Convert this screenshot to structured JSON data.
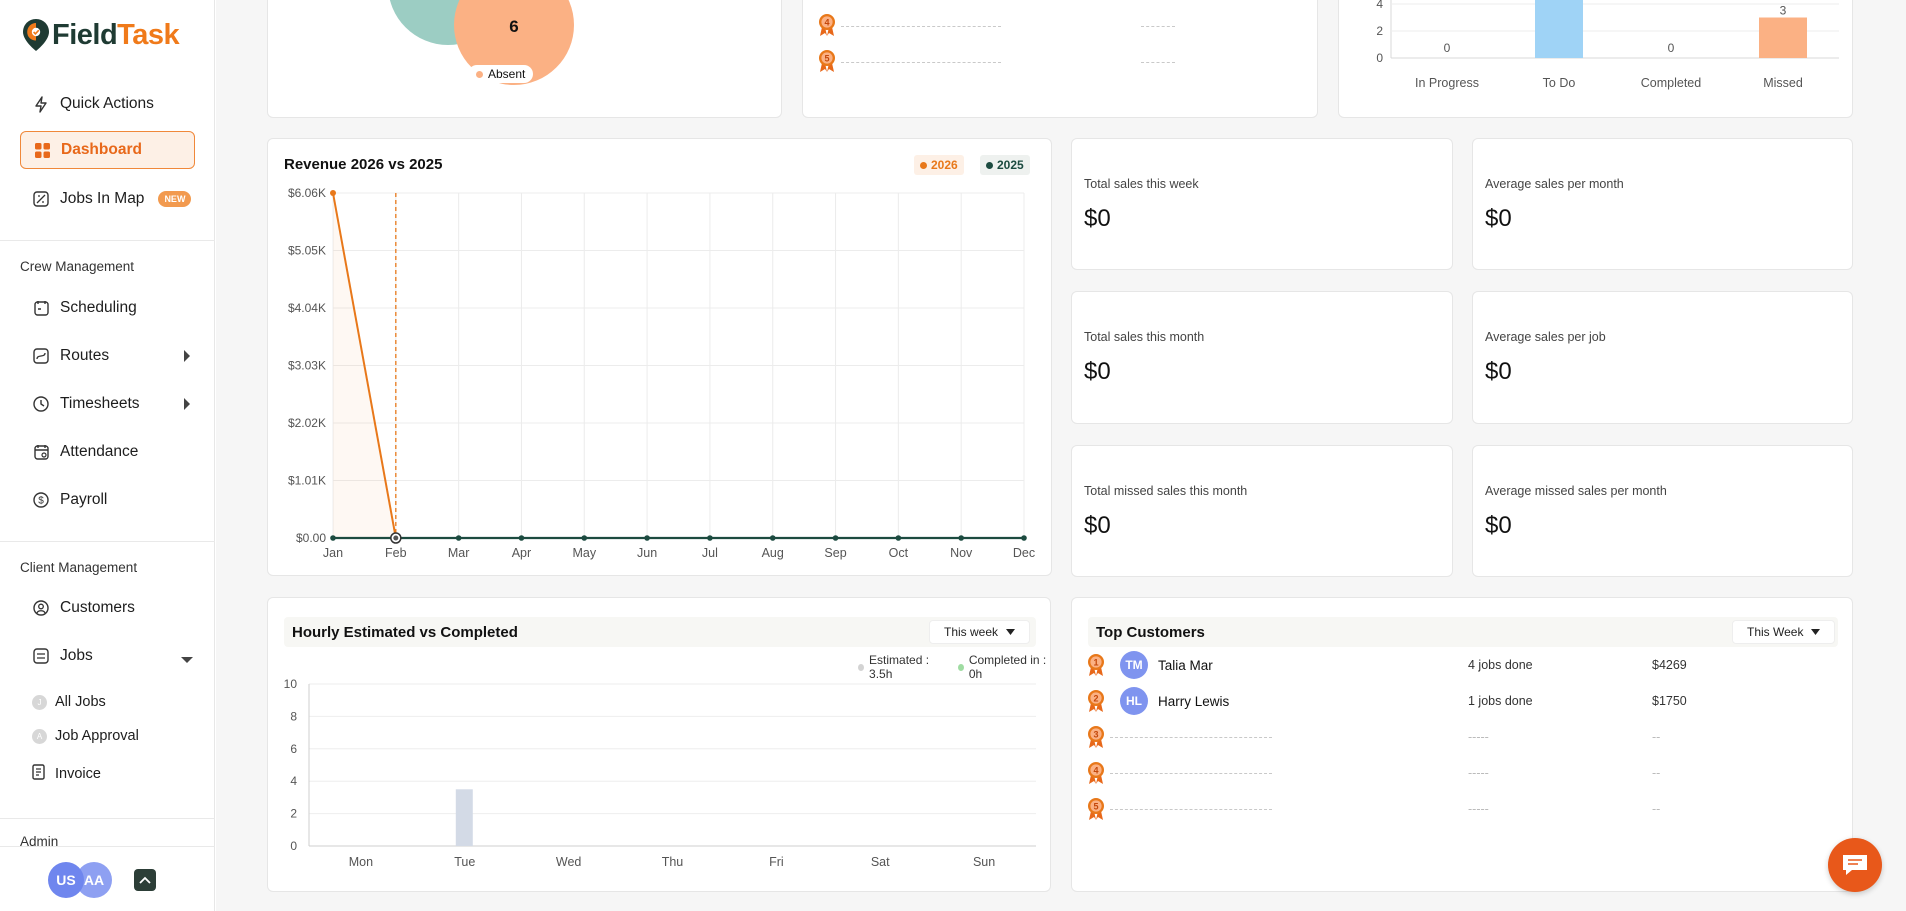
{
  "brand": {
    "name_a": "Field",
    "name_b": "Task"
  },
  "sidebar": {
    "quick_actions": "Quick Actions",
    "dashboard": "Dashboard",
    "jobs_in_map": "Jobs In Map",
    "new_badge": "NEW",
    "crew_management": "Crew Management",
    "scheduling": "Scheduling",
    "routes": "Routes",
    "timesheets": "Timesheets",
    "attendance": "Attendance",
    "payroll": "Payroll",
    "client_management": "Client Management",
    "customers": "Customers",
    "jobs": "Jobs",
    "all_jobs": "All Jobs",
    "job_approval": "Job Approval",
    "invoice": "Invoice",
    "admin": "Admin",
    "avatars": [
      "US",
      "AA"
    ]
  },
  "attendance_card": {
    "bubble_value": "6",
    "legend_absent": "Absent"
  },
  "top_card_ranks": [
    "4",
    "5"
  ],
  "job_status_chart": {
    "y_ticks": [
      "0",
      "2",
      "4"
    ],
    "categories": [
      "In Progress",
      "To Do",
      "Completed",
      "Missed"
    ],
    "values": [
      0,
      5,
      0,
      3
    ],
    "labels": [
      "0",
      "",
      "0",
      "3"
    ],
    "colors": [
      "#9fd3f6",
      "#9fd3f6",
      "#9fd3f6",
      "#fbb184"
    ]
  },
  "revenue": {
    "title": "Revenue 2026 vs 2025",
    "legend_2026": "2026",
    "legend_2025": "2025",
    "color_2026": "#e8781a",
    "color_2025": "#1c4b40",
    "y_ticks": [
      "$0.00",
      "$1.01K",
      "$2.02K",
      "$3.03K",
      "$4.04K",
      "$5.05K",
      "$6.06K"
    ]
  },
  "stats": {
    "total_week_label": "Total sales this week",
    "total_week_value": "$0",
    "avg_month_label": "Average sales per month",
    "avg_month_value": "$0",
    "total_month_label": "Total sales this month",
    "total_month_value": "$0",
    "avg_job_label": "Average sales per job",
    "avg_job_value": "$0",
    "missed_month_label": "Total missed sales this month",
    "missed_month_value": "$0",
    "avg_missed_label": "Average missed sales per month",
    "avg_missed_value": "$0"
  },
  "hourly": {
    "title": "Hourly Estimated vs Completed",
    "filter": "This week",
    "legend_estimated": "Estimated : 3.5h",
    "legend_completed": "Completed in : 0h",
    "y_ticks": [
      "0",
      "2",
      "4",
      "6",
      "8",
      "10"
    ]
  },
  "top_customers": {
    "title": "Top Customers",
    "filter": "This Week",
    "rows": [
      {
        "rank": "1",
        "initials": "TM",
        "name": "Talia Mar",
        "jobs": "4 jobs done",
        "amount": "$4269"
      },
      {
        "rank": "2",
        "initials": "HL",
        "name": "Harry Lewis",
        "jobs": "1 jobs done",
        "amount": "$1750"
      },
      {
        "rank": "3",
        "initials": "",
        "name": "",
        "jobs": "-----",
        "amount": "--"
      },
      {
        "rank": "4",
        "initials": "",
        "name": "",
        "jobs": "-----",
        "amount": "--"
      },
      {
        "rank": "5",
        "initials": "",
        "name": "",
        "jobs": "-----",
        "amount": "--"
      }
    ]
  },
  "chart_data": [
    {
      "type": "line",
      "title": "Revenue 2026 vs 2025",
      "categories": [
        "Jan",
        "Feb",
        "Mar",
        "Apr",
        "May",
        "Jun",
        "Jul",
        "Aug",
        "Sep",
        "Oct",
        "Nov",
        "Dec"
      ],
      "series": [
        {
          "name": "2026",
          "values": [
            6060,
            0,
            null,
            null,
            null,
            null,
            null,
            null,
            null,
            null,
            null,
            null
          ]
        },
        {
          "name": "2025",
          "values": [
            0,
            0,
            0,
            0,
            0,
            0,
            0,
            0,
            0,
            0,
            0,
            0
          ]
        }
      ],
      "ylim": [
        0,
        6060
      ],
      "grid": true,
      "legend": "top-right"
    },
    {
      "type": "bar",
      "title": "Hourly Estimated vs Completed",
      "categories": [
        "Mon",
        "Tue",
        "Wed",
        "Thu",
        "Fri",
        "Sat",
        "Sun"
      ],
      "series": [
        {
          "name": "Estimated",
          "values": [
            0,
            3.5,
            0,
            0,
            0,
            0,
            0
          ]
        },
        {
          "name": "Completed",
          "values": [
            0,
            0,
            0,
            0,
            0,
            0,
            0
          ]
        }
      ],
      "ylim": [
        0,
        10
      ],
      "grid": true,
      "legend": "top-right"
    }
  ]
}
